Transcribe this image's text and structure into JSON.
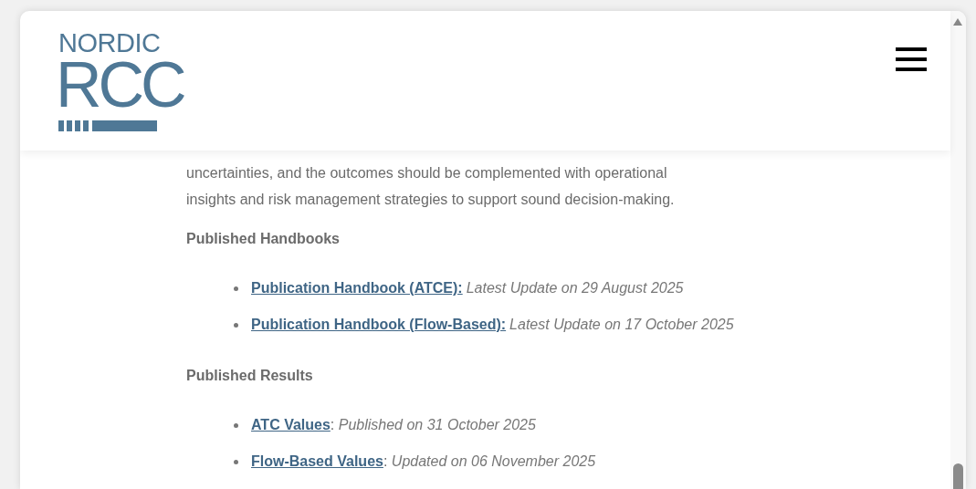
{
  "header": {
    "logo": {
      "top": "NORDIC",
      "main": "RCC"
    }
  },
  "paragraph_lines": [
    "uncertainties, and the outcomes should be complemented with operational",
    "insights and risk management strategies to support sound decision-making."
  ],
  "sections": [
    {
      "heading": "Published Handbooks",
      "items": [
        {
          "link": "Publication Handbook (ATCE):",
          "note": "Latest Update on 29 August 2025"
        },
        {
          "link": "Publication Handbook (Flow-Based):",
          "note": "Latest Update on 17 October 2025"
        }
      ]
    },
    {
      "heading": "Published Results",
      "items": [
        {
          "link": "ATC Values",
          "separator": ": ",
          "note": "Published on 31 October 2025"
        },
        {
          "link": "Flow-Based Values",
          "separator": ": ",
          "note": "Updated on 06 November 2025"
        }
      ]
    }
  ]
}
